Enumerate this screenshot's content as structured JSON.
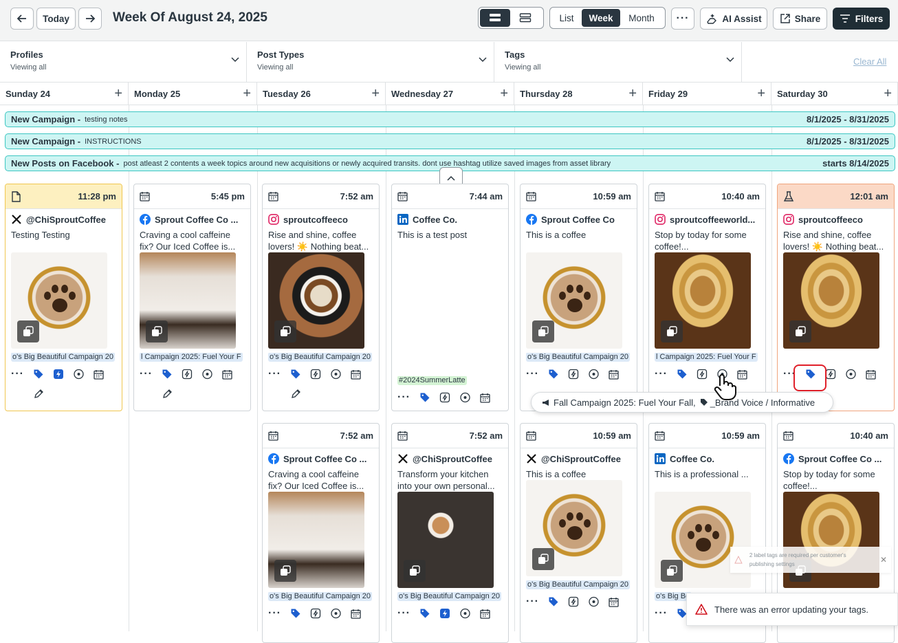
{
  "header": {
    "today_label": "Today",
    "week_title": "Week Of August 24, 2025",
    "view_tabs": [
      "List",
      "Week",
      "Month"
    ],
    "active_view": "Week",
    "ai_label": "AI Assist",
    "share_label": "Share",
    "filters_label": "Filters"
  },
  "filters": [
    {
      "label": "Profiles",
      "value": "Viewing all"
    },
    {
      "label": "Post Types",
      "value": "Viewing all"
    },
    {
      "label": "Tags",
      "value": "Viewing all"
    }
  ],
  "clear_all": "Clear All",
  "days": [
    "Sunday 24",
    "Monday 25",
    "Tuesday 26",
    "Wednesday 27",
    "Thursday 28",
    "Friday 29",
    "Saturday 30"
  ],
  "campaigns": [
    {
      "title": "New Campaign -",
      "note": "testing notes",
      "dates": "8/1/2025 - 8/31/2025"
    },
    {
      "title": "New Campaign -",
      "note": "INSTRUCTIONS",
      "dates": "8/1/2025 - 8/31/2025"
    },
    {
      "title": "New Posts on Facebook -",
      "note": "post atleast 2 contents a week topics around new acquisitions or newly acquired transits. dont use hashtag utilize saved images from asset library",
      "dates": "starts 8/14/2025"
    }
  ],
  "cards_row1": [
    {
      "time": "11:28 pm",
      "network": "x",
      "profile": "@ChiSproutCoffee",
      "text": "Testing Testing",
      "tag": "o's Big Beautiful Campaign 20",
      "head_icon": "draft"
    },
    {
      "time": "5:45 pm",
      "network": "facebook",
      "profile": "Sprout Coffee Co ...",
      "text": "Craving a cool caffeine fix? Our Iced Coffee is...",
      "tag": "l Campaign 2025: Fuel Your F",
      "head_icon": "calendar"
    },
    {
      "time": "7:52 am",
      "network": "instagram",
      "profile": "sproutcoffeeco",
      "text": "Rise and shine, coffee lovers! ☀️ Nothing beat...",
      "tag": "o's Big Beautiful Campaign 20",
      "head_icon": "calendar"
    },
    {
      "time": "7:44 am",
      "network": "linkedin",
      "profile": "Coffee Co.",
      "text": "This is a test post",
      "tag": "#2024SummerLatte",
      "head_icon": "calendar"
    },
    {
      "time": "10:59 am",
      "network": "facebook",
      "profile": "Sprout Coffee Co",
      "text": "This is a coffee",
      "tag": "o's Big Beautiful Campaign 20",
      "head_icon": "calendar"
    },
    {
      "time": "10:40 am",
      "network": "instagram",
      "profile": "sproutcoffeeworld...",
      "text": "Stop by today for some coffee!...",
      "tag": "l Campaign 2025: Fuel Your F",
      "head_icon": "calendar"
    },
    {
      "time": "12:01 am",
      "network": "instagram",
      "profile": "sproutcoffeeco",
      "text": "Rise and shine, coffee lovers! ☀️ Nothing beat...",
      "tag": "",
      "head_icon": "flask"
    }
  ],
  "cards_row2": [
    {
      "time": "7:52 am",
      "network": "facebook",
      "profile": "Sprout Coffee Co ...",
      "text": "Craving a cool caffeine fix? Our Iced Coffee is...",
      "tag": "o's Big Beautiful Campaign 20"
    },
    {
      "time": "7:52 am",
      "network": "x",
      "profile": "@ChiSproutCoffee",
      "text": "Transform your kitchen into your own personal...",
      "tag": "o's Big Beautiful Campaign 20"
    },
    {
      "time": "10:59 am",
      "network": "x",
      "profile": "@ChiSproutCoffee",
      "text": "This is a coffee",
      "tag": "o's Big Beautiful Campaign 20"
    },
    {
      "time": "10:59 am",
      "network": "linkedin",
      "profile": "Coffee Co.",
      "text": "This is a professional ...",
      "tag": "o's Big Be"
    },
    {
      "time": "10:40 am",
      "network": "facebook",
      "profile": "Sprout Coffee Co ...",
      "text": "Stop by today for some coffee!...",
      "tag": ""
    }
  ],
  "tooltip": {
    "campaign": "Fall Campaign 2025: Fuel Your Fall,",
    "tag": "_Brand Voice / Informative"
  },
  "ghost_msg": "2 label tags are required per customer's publishing settings",
  "toast": "There was an error updating your tags.",
  "colors": {
    "accent": "#2a3640",
    "campaign_bg": "#cdf5f3",
    "campaign_border": "#3cc6c2",
    "tag_blue": "#1d5fcf",
    "error": "#d0101b"
  }
}
